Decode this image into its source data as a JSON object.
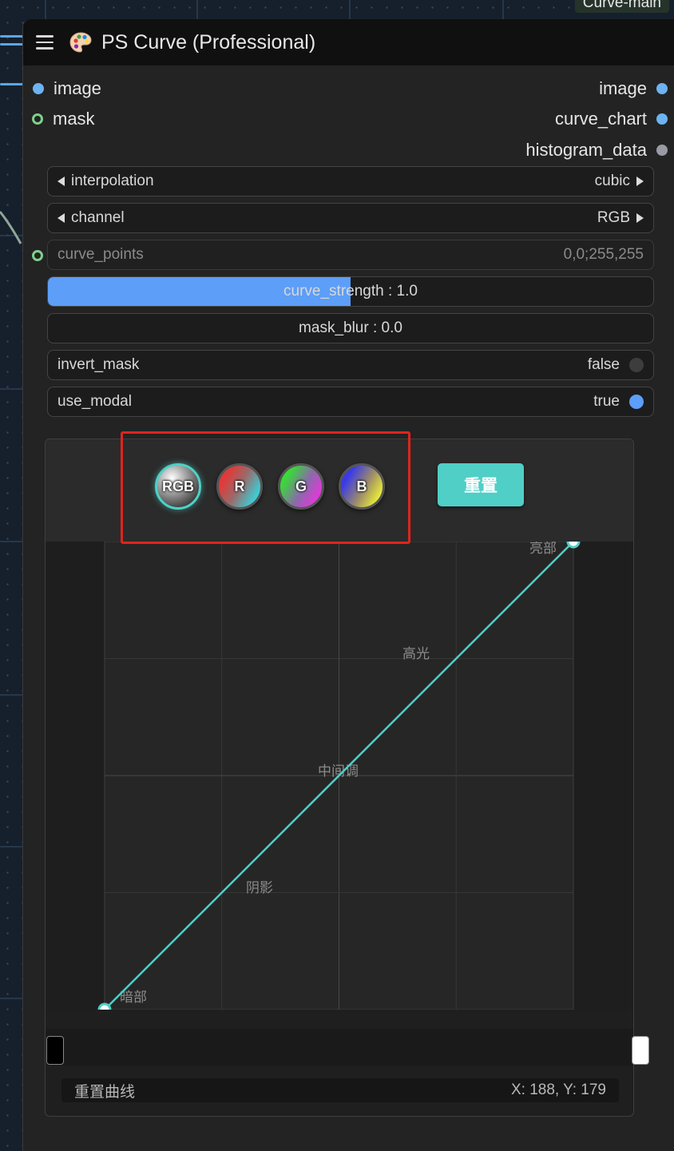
{
  "canvas": {
    "top_tag": "Curve-main"
  },
  "node": {
    "title": "PS Curve (Professional)",
    "inputs": [
      {
        "label": "image"
      },
      {
        "label": "mask"
      }
    ],
    "outputs": [
      {
        "label": "image"
      },
      {
        "label": "curve_chart"
      },
      {
        "label": "histogram_data"
      }
    ],
    "widgets": {
      "interpolation": {
        "label": "interpolation",
        "value": "cubic"
      },
      "channel": {
        "label": "channel",
        "value": "RGB"
      },
      "curve_points": {
        "label": "curve_points",
        "value": "0,0;255,255"
      },
      "curve_strength": {
        "text": "curve_strength : 1.0",
        "value": 1.0,
        "min": 0,
        "max": 2
      },
      "mask_blur": {
        "text": "mask_blur : 0.0"
      },
      "invert_mask": {
        "label": "invert_mask",
        "value": "false"
      },
      "use_modal": {
        "label": "use_modal",
        "value": "true"
      }
    }
  },
  "editor": {
    "channels": [
      {
        "label": "RGB",
        "selected": true
      },
      {
        "label": "R",
        "selected": false
      },
      {
        "label": "G",
        "selected": false
      },
      {
        "label": "B",
        "selected": false
      }
    ],
    "reset_button": "重置",
    "zone_labels": {
      "highlights_end": "亮部",
      "highlights": "高光",
      "midtones": "中间调",
      "shadows": "阴影",
      "shadows_end": "暗部"
    },
    "status_left": "重置曲线",
    "status_right": "X: 188, Y: 179"
  },
  "chart_data": {
    "type": "line",
    "series": [
      {
        "x": [
          0,
          255
        ],
        "y": [
          0,
          255
        ]
      }
    ],
    "xlim": [
      0,
      255
    ],
    "ylim": [
      0,
      255
    ],
    "grid": true,
    "colors": {
      "curve": "#4fcfc6",
      "point_fill": "#ffffff"
    }
  },
  "colors": {
    "accent_teal": "#4fcfc6",
    "slider_blue": "#5c9ef8",
    "highlight_red": "#e0241c",
    "input_blue": "#6db3f2",
    "input_green": "#7ed08a"
  }
}
